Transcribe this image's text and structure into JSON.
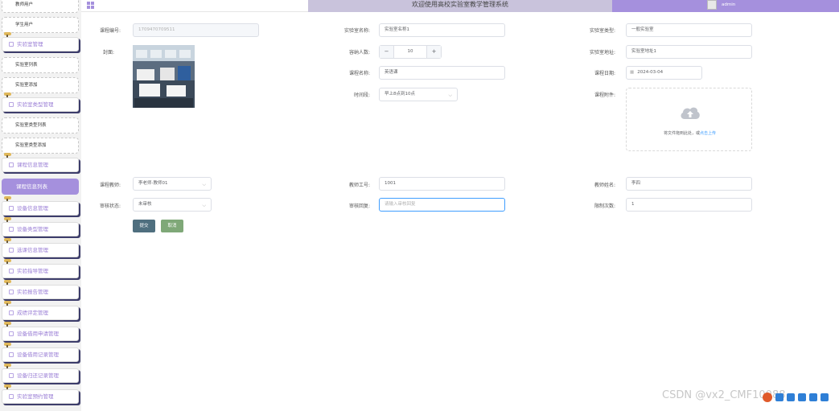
{
  "header": {
    "title": "欢迎使用高校实验室教学管理系统",
    "username": "admin"
  },
  "sidebar": {
    "items": [
      {
        "label": "教师用户",
        "type": "sub"
      },
      {
        "label": "学生用户",
        "type": "sub"
      },
      {
        "label": "实验室管理",
        "type": "menu"
      },
      {
        "label": "实验室列表",
        "type": "sub"
      },
      {
        "label": "实验室添加",
        "type": "sub"
      },
      {
        "label": "实验室类型管理",
        "type": "menu"
      },
      {
        "label": "实验室类型列表",
        "type": "sub"
      },
      {
        "label": "实验室类型添加",
        "type": "sub"
      },
      {
        "label": "课程信息管理",
        "type": "menu"
      },
      {
        "label": "课程信息列表",
        "type": "active"
      },
      {
        "label": "设备信息管理",
        "type": "menu"
      },
      {
        "label": "设备类型管理",
        "type": "menu"
      },
      {
        "label": "选课信息管理",
        "type": "menu"
      },
      {
        "label": "实验指导管理",
        "type": "menu"
      },
      {
        "label": "实验报告管理",
        "type": "menu"
      },
      {
        "label": "成绩评定管理",
        "type": "menu"
      },
      {
        "label": "设备借用申请管理",
        "type": "menu"
      },
      {
        "label": "设备借用记录管理",
        "type": "menu"
      },
      {
        "label": "设备归还记录管理",
        "type": "menu"
      },
      {
        "label": "实验室预约管理",
        "type": "menu"
      }
    ]
  },
  "form": {
    "course_no": {
      "label": "课程编号:",
      "value": "1709470709511"
    },
    "lab_name": {
      "label": "实验室名称:",
      "value": "实验室名称1"
    },
    "lab_type": {
      "label": "实验室类型:",
      "value": "一般实验室"
    },
    "cover": {
      "label": "封面:"
    },
    "capacity": {
      "label": "容纳人数:",
      "value": "10",
      "minus": "−",
      "plus": "+"
    },
    "lab_location": {
      "label": "实验室地址:",
      "value": "实验室地址1"
    },
    "course_name": {
      "label": "课程名称:",
      "value": "英语课"
    },
    "course_date": {
      "label": "课程日期:",
      "value": "2024-03-04"
    },
    "time_slot": {
      "label": "时间段:",
      "value": "早上8点到10点"
    },
    "attachment": {
      "label": "课程附件:",
      "hint_prefix": "将文件拖到此处，或",
      "hint_link": "点击上传"
    },
    "teacher_account": {
      "label": "课程教师:",
      "value": "李老师-教师01"
    },
    "teacher_no": {
      "label": "教师工号:",
      "value": "1001"
    },
    "teacher_name": {
      "label": "教师姓名:",
      "value": "李四"
    },
    "audit_status": {
      "label": "审核状态:",
      "value": "未审核"
    },
    "audit_reply": {
      "label": "审核回复:",
      "placeholder": "请输入审核回复"
    },
    "limit_count": {
      "label": "限制次数:",
      "value": "1"
    }
  },
  "buttons": {
    "submit": "提交",
    "cancel": "取消"
  },
  "watermark": "CSDN @vx2_CMF10088",
  "colors": {
    "accent": "#a590dd",
    "header_mid": "#c9c3dc",
    "submit": "#4f6f7f",
    "cancel": "#7fa878",
    "link": "#409eff"
  }
}
